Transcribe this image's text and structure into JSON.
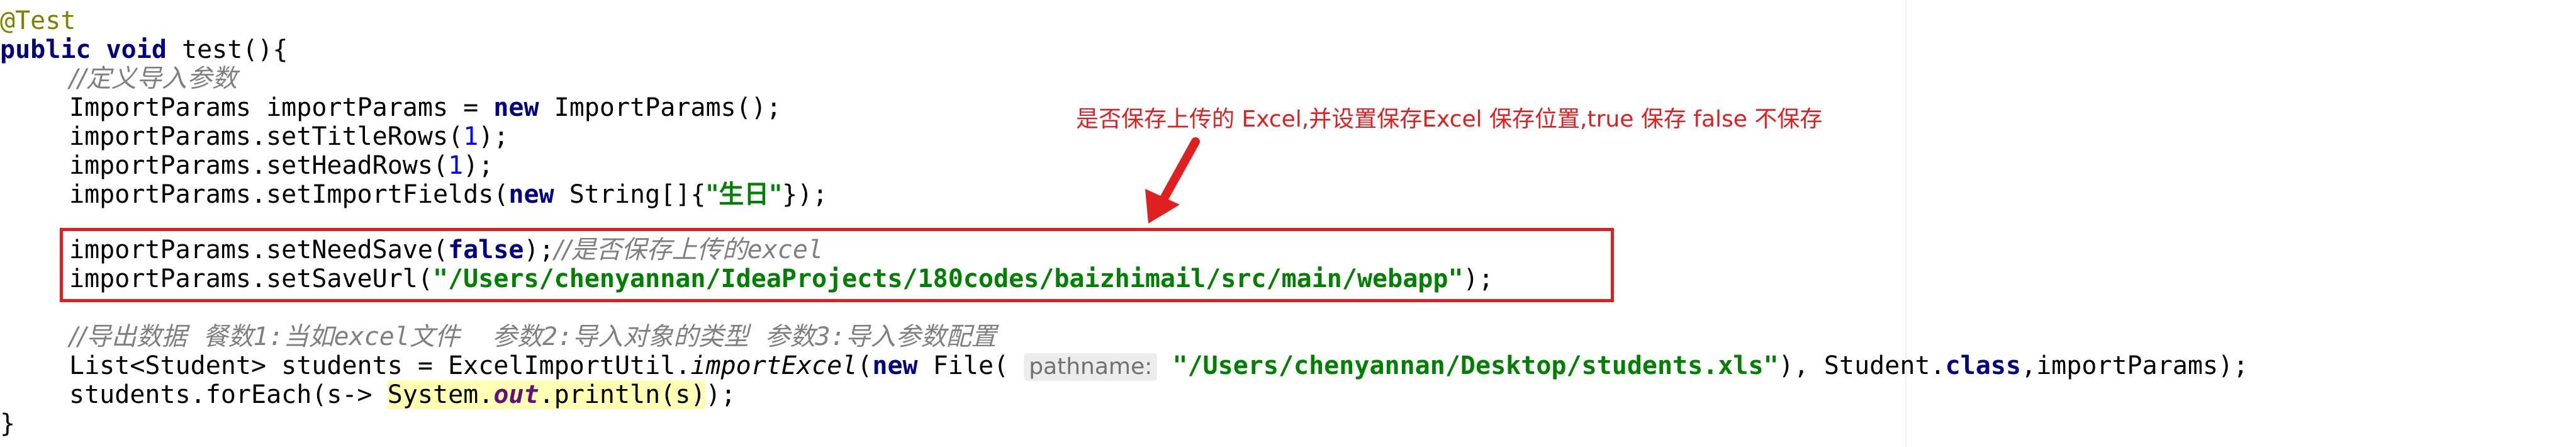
{
  "code": {
    "annotation": "@Test",
    "method": {
      "modifiers": "public void",
      "signature": " test(){"
    },
    "comment_define": "//定义导入参数",
    "line_new": {
      "decl": "ImportParams importParams = ",
      "kw": "new",
      "rest": " ImportParams();"
    },
    "line_title": {
      "pre": "importParams.setTitleRows(",
      "num": "1",
      "post": ");"
    },
    "line_head": {
      "pre": "importParams.setHeadRows(",
      "num": "1",
      "post": ");"
    },
    "line_fields": {
      "pre": "importParams.setImportFields(",
      "kw": "new",
      "mid": " String[]{",
      "str": "\"生日\"",
      "post": "});"
    },
    "line_needsave": {
      "pre": "importParams.setNeedSave(",
      "kw": "false",
      "post": ");",
      "cmt_cn": "//是否保存上传的",
      "cmt_en": "excel"
    },
    "line_saveurl": {
      "pre": "importParams.setSaveUrl(",
      "str": "\"/Users/chenyannan/IdeaProjects/180codes/baizhimail/src/main/webapp\"",
      "post": ");"
    },
    "comment_export": {
      "p1": "//导出数据  餐数",
      "p2": "1:",
      "p3": "当如",
      "p4": "excel",
      "p5": "文件    参数",
      "p6": "2:",
      "p7": "导入对象的类型  参数",
      "p8": "3:",
      "p9": "导入参数配置"
    },
    "line_students": {
      "pre": "List<Student> students = ExcelImportUtil.",
      "method": "importExcel",
      "open": "(",
      "kw": "new",
      "file": " File( ",
      "hint": "pathname:",
      "str": " \"/Users/chenyannan/Desktop/students.xls\"",
      "mid": "), Student.",
      "kw2": "class",
      "post": ",importParams);"
    },
    "line_foreach": {
      "pre": "students.forEach(s-> ",
      "hl_a": "System.",
      "hl_field": "out",
      "hl_b": ".println(s)",
      "post": ");"
    },
    "closing": "}"
  },
  "annotation_note": "是否保存上传的 Excel,并设置保存Excel 保存位置,true 保存 false 不保存",
  "colors": {
    "keyword": "#000080",
    "string": "#008000",
    "comment": "#808080",
    "annotation": "#808000",
    "number": "#0000ff",
    "highlight_red": "#e02020"
  }
}
